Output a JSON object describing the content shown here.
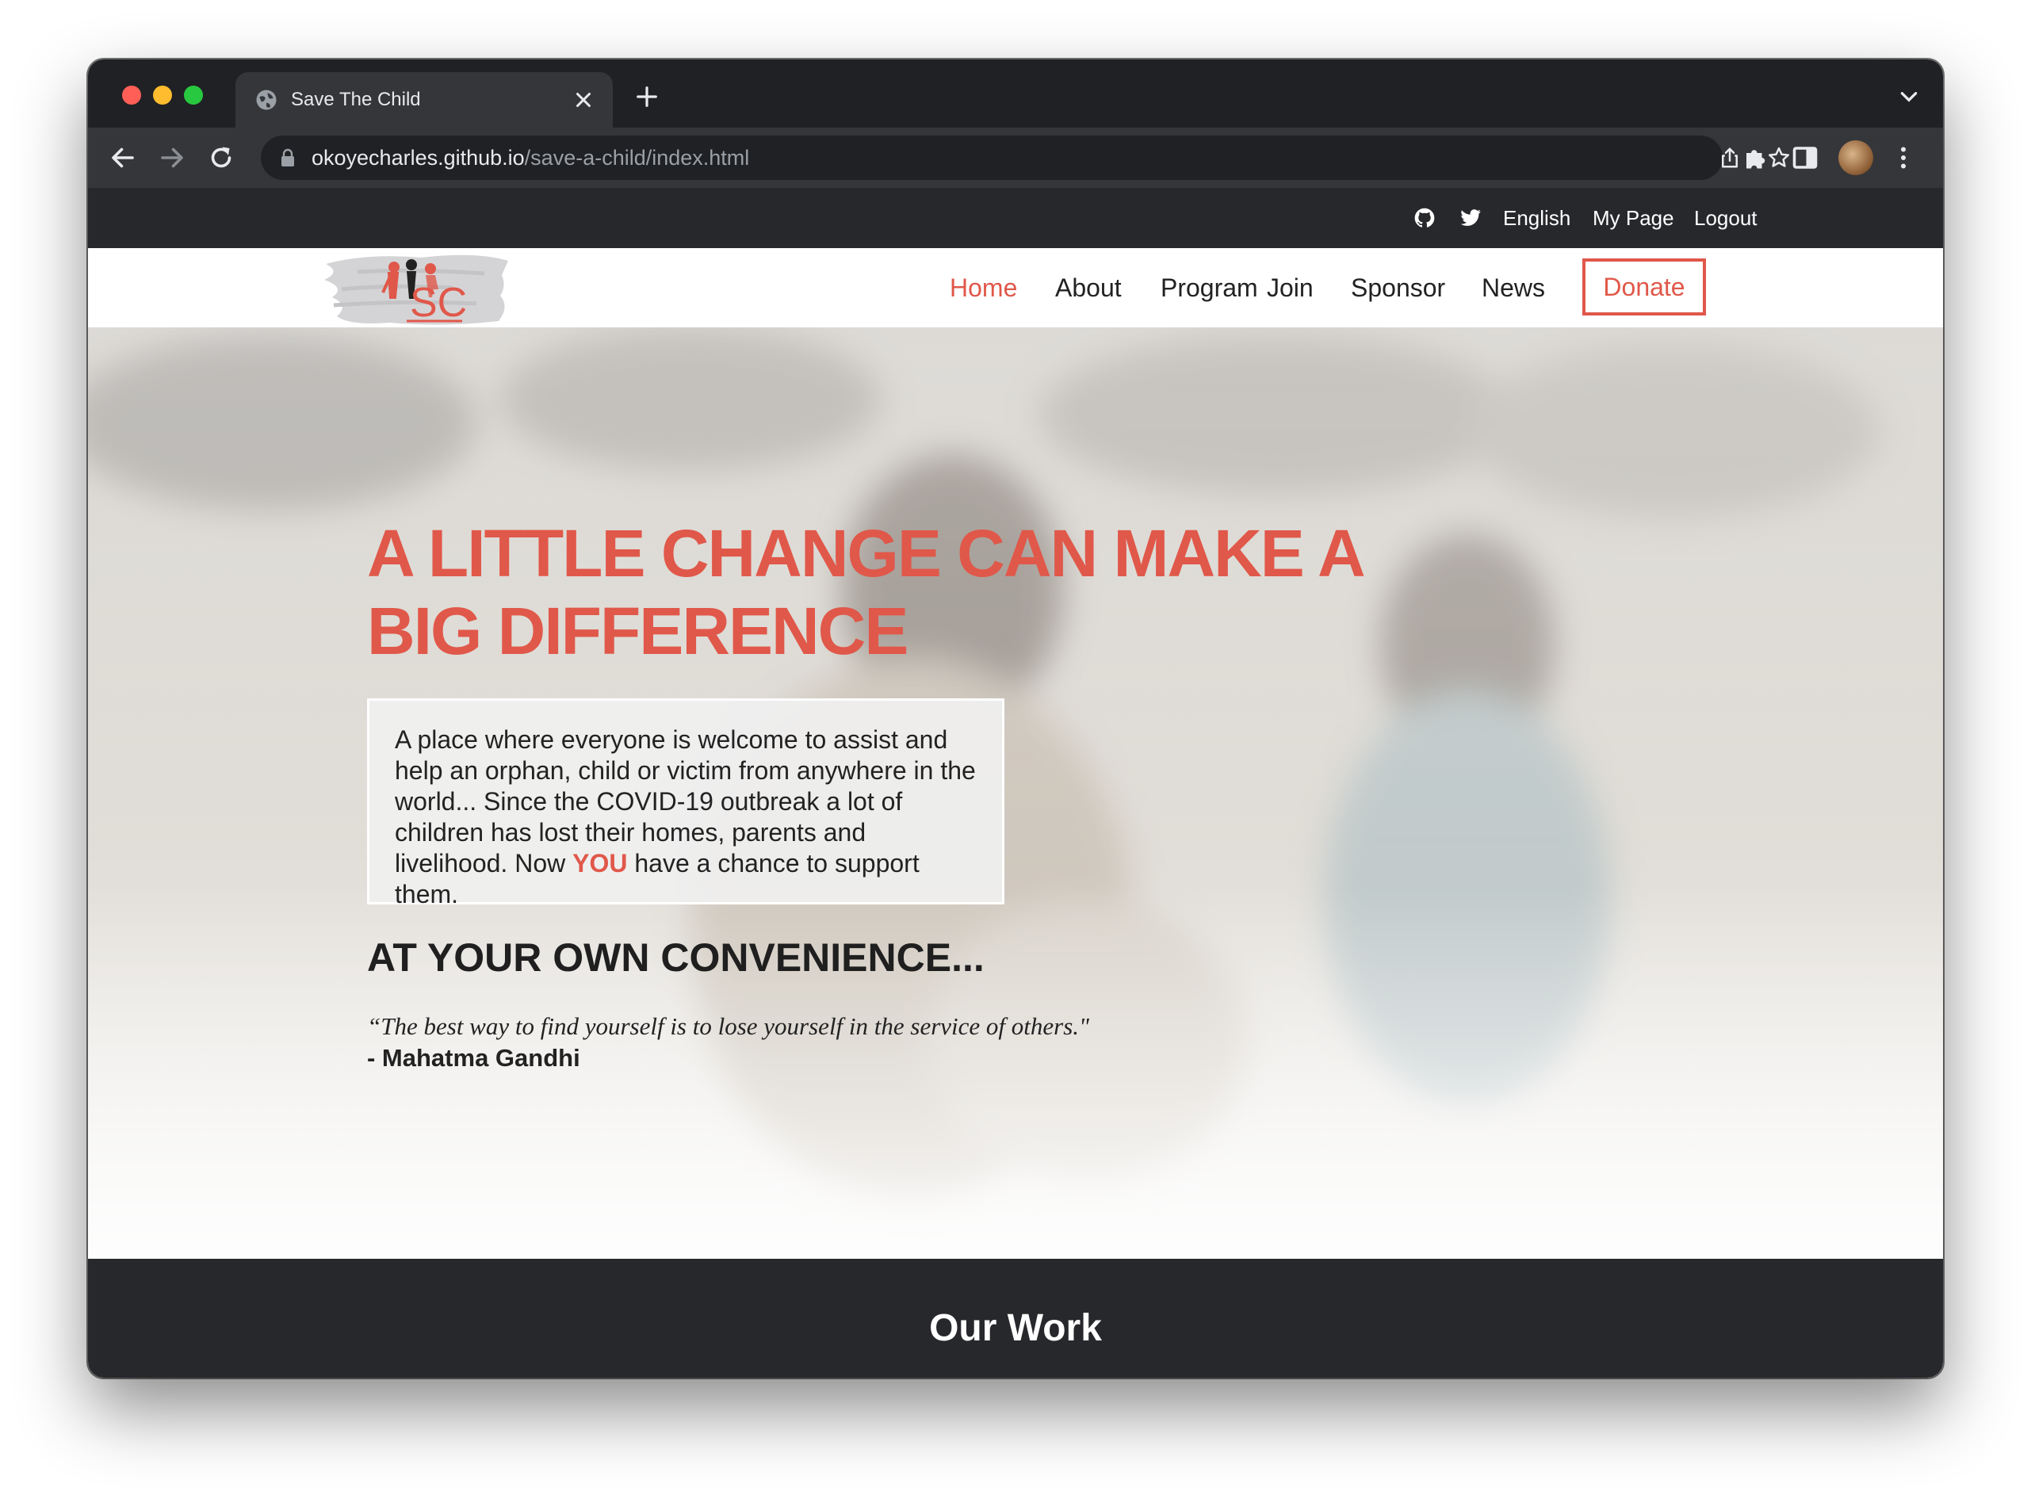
{
  "browser": {
    "tab_title": "Save The Child",
    "url_host": "okoyecharles.github.io",
    "url_path": "/save-a-child/index.html"
  },
  "topbar": {
    "language": "English",
    "my_page": "My Page",
    "logout": "Logout",
    "icons": [
      "github-icon",
      "twitter-icon"
    ]
  },
  "logo": {
    "text": "SC"
  },
  "nav": {
    "items": [
      "Home",
      "About",
      "Program",
      "Join",
      "Sponsor",
      "News"
    ],
    "donate": "Donate"
  },
  "hero": {
    "title_line1": "A LITTLE CHANGE CAN MAKE A",
    "title_line2": "BIG DIFFERENCE",
    "text_before": "A place where everyone is welcome to assist and help an orphan, child or victim from anywhere in the world... Since the COVID-19 outbreak a lot of children has lost their homes, parents and livelihood. Now ",
    "text_highlight": "YOU",
    "text_after": " have a chance to support them.",
    "subheading": "AT YOUR OWN CONVENIENCE...",
    "quote": "“The best way to find yourself is to lose yourself in the service of others.\"",
    "quote_author": "- Mahatma Gandhi"
  },
  "section": {
    "our_work": "Our Work"
  },
  "colors": {
    "accent": "#e0584a",
    "dark_bar": "#27282c",
    "chrome_dark": "#202124",
    "chrome_toolbar": "#35363a"
  }
}
